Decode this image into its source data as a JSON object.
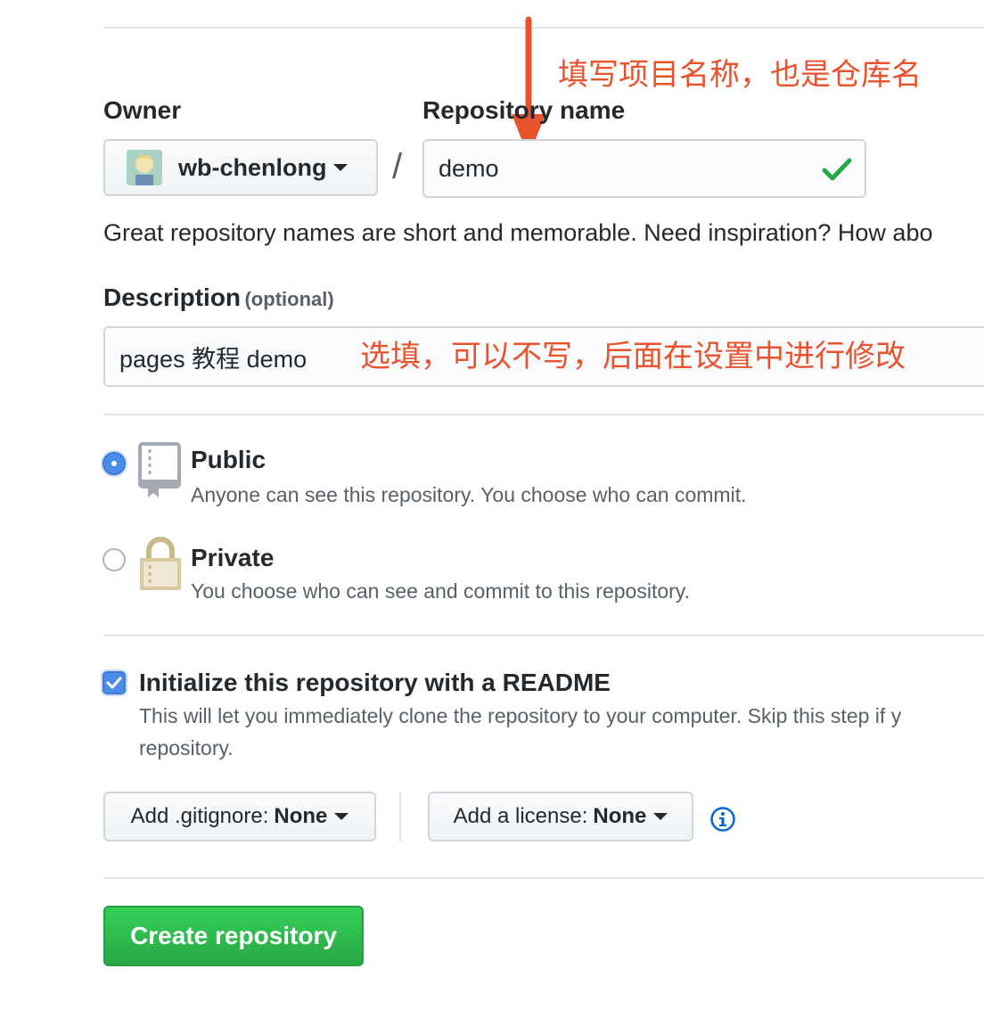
{
  "owner": {
    "label": "Owner",
    "name": "wb-chenlong"
  },
  "separator": "/",
  "repo": {
    "label": "Repository name",
    "value": "demo"
  },
  "hint_text": "Great repository names are short and memorable. Need inspiration? How abo",
  "description": {
    "label": "Description",
    "optional": "(optional)",
    "value": "pages 教程 demo"
  },
  "annotations": {
    "repo_name": "填写项目名称，也是仓库名",
    "description": "选填，可以不写，后面在设置中进行修改",
    "color": "#e8532e"
  },
  "visibility": {
    "public": {
      "title": "Public",
      "desc": "Anyone can see this repository. You choose who can commit.",
      "selected": true
    },
    "private": {
      "title": "Private",
      "desc": "You choose who can see and commit to this repository.",
      "selected": false
    }
  },
  "readme": {
    "checked": true,
    "title": "Initialize this repository with a README",
    "desc_line1": "This will let you immediately clone the repository to your computer. Skip this step if y",
    "desc_line2": "repository."
  },
  "gitignore": {
    "prefix": "Add .gitignore:",
    "value": "None"
  },
  "license": {
    "prefix": "Add a license:",
    "value": "None"
  },
  "create_button": "Create repository",
  "colors": {
    "accent_blue": "#4b8ce8",
    "green_button": "#28a745",
    "valid_check": "#28a745",
    "info_icon": "#0366d6"
  }
}
